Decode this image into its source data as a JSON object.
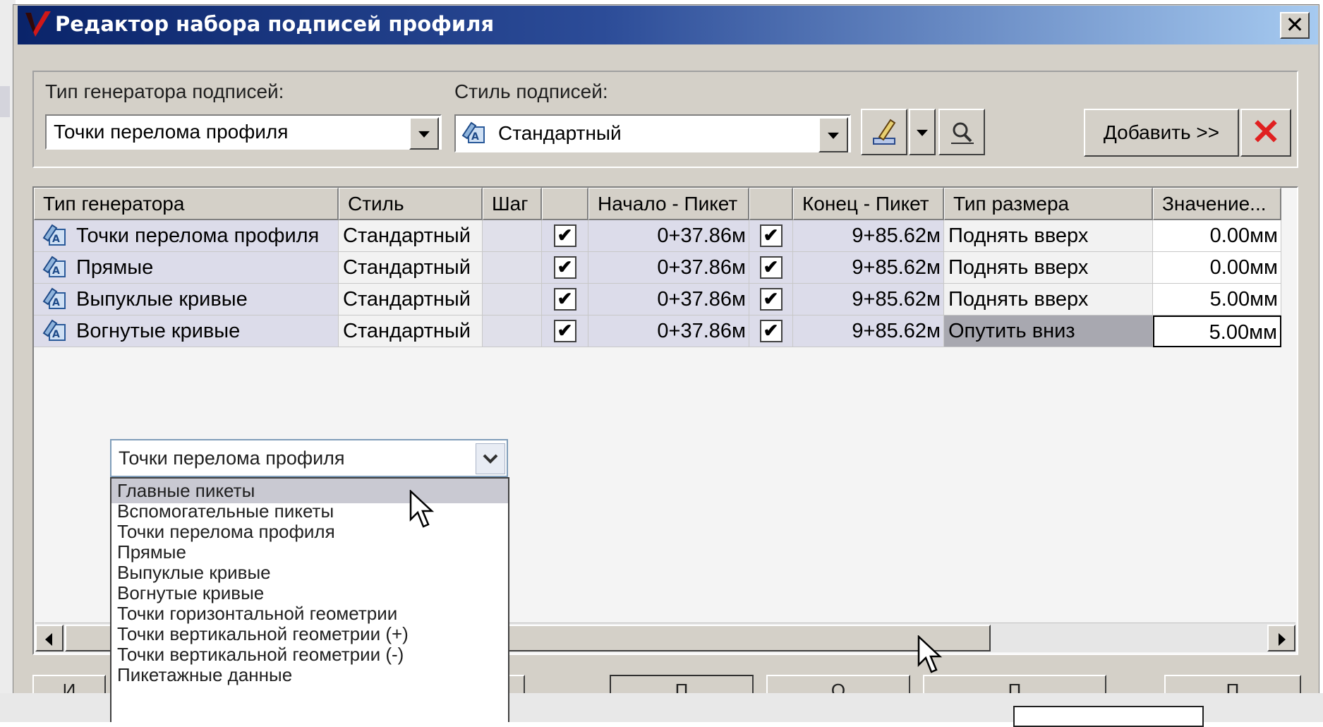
{
  "window": {
    "title": "Редактор набора подписей профиля",
    "close_label": "✕"
  },
  "top": {
    "generator_label": "Тип генератора подписей:",
    "generator_value": "Точки перелома профиля",
    "style_label": "Стиль подписей:",
    "style_value": "Стандартный",
    "add_label": "Добавить >>",
    "delete_label": "✕"
  },
  "grid": {
    "columns": [
      "Тип генератора",
      "Стиль",
      "Шаг",
      "",
      "Начало - Пикет",
      "",
      "Конец - Пикет",
      "Тип размера",
      "Значение..."
    ],
    "rows": [
      {
        "name": "Точки перелома профиля",
        "style": "Стандартный",
        "step": "",
        "start_check": "✔",
        "start": "0+37.86м",
        "end_check": "✔",
        "end": "9+85.62м",
        "dim_type": "Поднять вверх",
        "value": "0.00мм"
      },
      {
        "name": "Прямые",
        "style": "Стандартный",
        "step": "",
        "start_check": "✔",
        "start": "0+37.86м",
        "end_check": "✔",
        "end": "9+85.62м",
        "dim_type": "Поднять вверх",
        "value": "0.00мм"
      },
      {
        "name": "Выпуклые кривые",
        "style": "Стандартный",
        "step": "",
        "start_check": "✔",
        "start": "0+37.86м",
        "end_check": "✔",
        "end": "9+85.62м",
        "dim_type": "Поднять вверх",
        "value": "5.00мм"
      },
      {
        "name": "Вогнутые кривые",
        "style": "Стандартный",
        "step": "",
        "start_check": "✔",
        "start": "0+37.86м",
        "end_check": "✔",
        "end": "9+85.62м",
        "dim_type": "Опутить вниз",
        "value": "5.00мм"
      }
    ]
  },
  "dropdown": {
    "current": "Точки перелома профиля",
    "selected_index": 0,
    "options": [
      "Главные пикеты",
      "Вспомогательные пикеты",
      "Точки перелома профиля",
      "Прямые",
      "Выпуклые кривые",
      "Вогнутые кривые",
      "Точки горизонтальной геометрии",
      "Точки вертикальной геометрии (+)",
      "Точки вертикальной геометрии (-)",
      "Пикетажные данные"
    ]
  },
  "bottom_buttons": [
    "И",
    "",
    "П",
    "О",
    "П",
    "П"
  ],
  "colors": {
    "title_start": "#0a246a",
    "title_end": "#a6caf0",
    "dialog": "#d4d0c8",
    "delete": "#e02020"
  }
}
